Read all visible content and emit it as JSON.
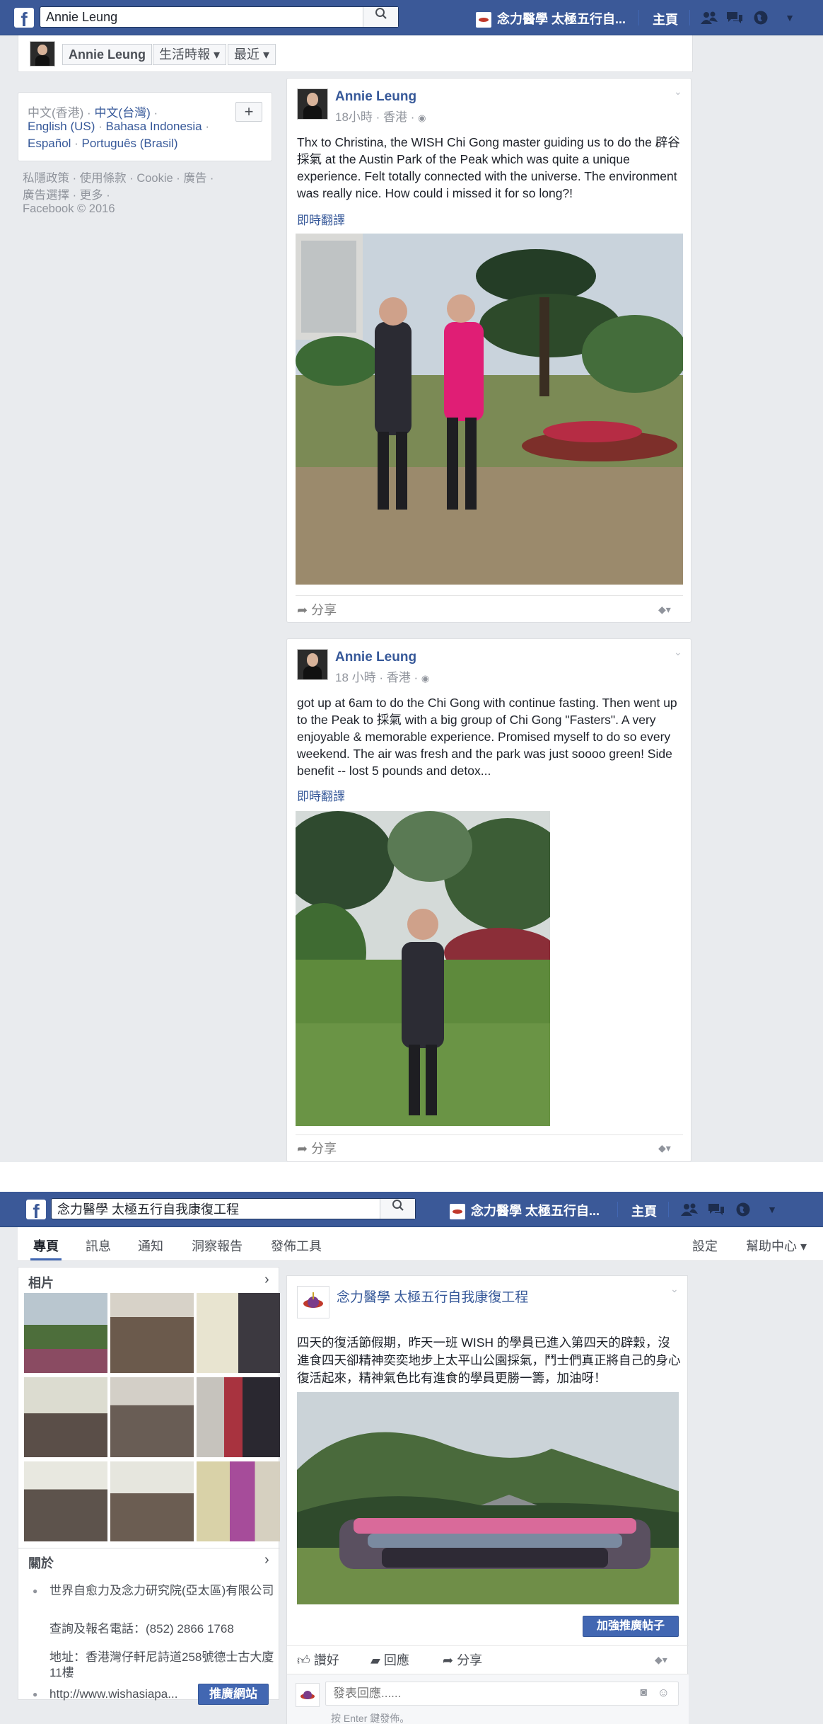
{
  "shot1": {
    "topbar": {
      "search_value": "Annie Leung",
      "page_name": "念力醫學 太極五行自...",
      "home_label": "主頁"
    },
    "crumbs": {
      "name": "Annie Leung",
      "timeline": "生活時報 ▾",
      "recent": "最近 ▾"
    },
    "languages": {
      "line1": [
        "中文(香港)",
        "中文(台灣)"
      ],
      "line2": [
        "English (US)",
        "Bahasa Indonesia"
      ],
      "line3": [
        "Español",
        "Português (Brasil)"
      ],
      "add_label": "+"
    },
    "footer": {
      "line1": "私隱政策 · 使用條款 · Cookie · 廣告 ·",
      "line2": "廣告選擇 · 更多 ·",
      "line3": "Facebook © 2016"
    },
    "post1": {
      "author": "Annie Leung",
      "meta": "18小時 · 香港 ·",
      "text": "Thx to Christina, the WISH Chi Gong master guiding us to do the 辟谷採氣 at the Austin Park of the Peak which was quite a unique experience. Felt totally connected with the universe. The environment was really nice. How could i missed it for so long?!",
      "translate": "即時翻譯",
      "share": "分享"
    },
    "post2": {
      "author": "Annie Leung",
      "meta": "18 小時 · 香港 ·",
      "text": "got up at 6am to do the Chi Gong with continue fasting. Then went up to the Peak to 採氣 with a big group of Chi Gong \"Fasters\". A very enjoyable & memorable experience. Promised myself to do so every weekend. The air was fresh and the park was just soooo green! Side benefit -- lost 5 pounds and detox...",
      "translate": "即時翻譯",
      "share": "分享"
    }
  },
  "shot2": {
    "topbar": {
      "search_value": "念力醫學 太極五行自我康復工程",
      "page_name": "念力醫學 太極五行自...",
      "home_label": "主頁"
    },
    "tabs": [
      "專頁",
      "訊息",
      "通知",
      "洞察報告",
      "發佈工具"
    ],
    "right_tabs": {
      "settings": "設定",
      "help": "幫助中心 ▾"
    },
    "photos_title": "相片",
    "about": {
      "title": "關於",
      "org": "世界自愈力及念力研究院(亞太區)有限公司",
      "phone": "查詢及報名電話：(852) 2866 1768",
      "address": "地址：香港灣仔軒尼詩道258號德士古大廈11樓",
      "website": "http://www.wishasiapa...",
      "promote_site": "推廣網站"
    },
    "post": {
      "author": "念力醫學 太極五行自我康復工程",
      "text": "四天的復活節假期，昨天一班 WISH 的學員已進入第四天的辟穀，沒進食四天卻精神奕奕地步上太平山公園採氣，鬥士們真正將自己的身心復活起來，精神氣色比有進食的學員更勝一籌，加油呀！",
      "boost": "加強推廣帖子",
      "like": "讚好",
      "comment": "回應",
      "share": "分享",
      "comment_placeholder": "發表回應......",
      "comment_hint": "按 Enter 鍵發佈。"
    }
  }
}
